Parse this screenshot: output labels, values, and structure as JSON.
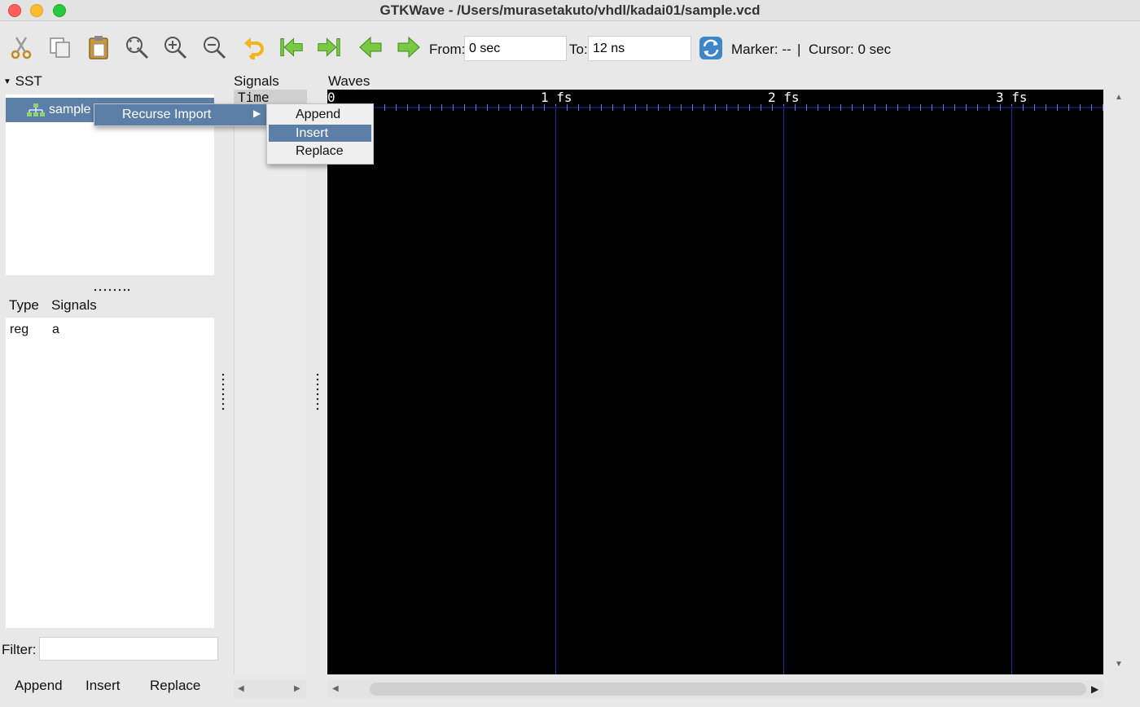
{
  "window": {
    "title": "GTKWave - /Users/murasetakuto/vhdl/kadai01/sample.vcd"
  },
  "toolbar": {
    "icons": [
      "cut-icon",
      "copy-icon",
      "paste-icon",
      "zoom-fit-icon",
      "zoom-in-icon",
      "zoom-out-icon",
      "undo-icon",
      "go-begin-icon",
      "go-end-icon",
      "go-back-icon",
      "go-forward-icon",
      "reload-icon"
    ],
    "from_label": "From:",
    "from_value": "0 sec",
    "to_label": "To:",
    "to_value": "12 ns",
    "marker_text": "Marker: --",
    "separator": "|",
    "cursor_text": "Cursor: 0 sec"
  },
  "sst": {
    "label": "SST",
    "tree_item": "sample"
  },
  "signal_list": {
    "type_header": "Type",
    "signals_header": "Signals",
    "rows": [
      {
        "type": "reg",
        "name": "a"
      }
    ]
  },
  "filter": {
    "label": "Filter:",
    "value": ""
  },
  "bottom_buttons": {
    "append": "Append",
    "insert": "Insert",
    "replace": "Replace"
  },
  "signals_pane": {
    "label": "Signals",
    "header": "Time"
  },
  "waves": {
    "label": "Waves",
    "ruler": [
      "0",
      "1 fs",
      "2 fs",
      "3 fs"
    ]
  },
  "context_menu": {
    "recurse_import": "Recurse Import",
    "submenu": [
      "Append",
      "Insert",
      "Replace"
    ],
    "highlighted": "Insert"
  },
  "colors": {
    "selection": "#5b7fa6",
    "wave_bg": "#000000",
    "grid_line": "#1f2aa8",
    "arrow_green": "#7ac943"
  }
}
